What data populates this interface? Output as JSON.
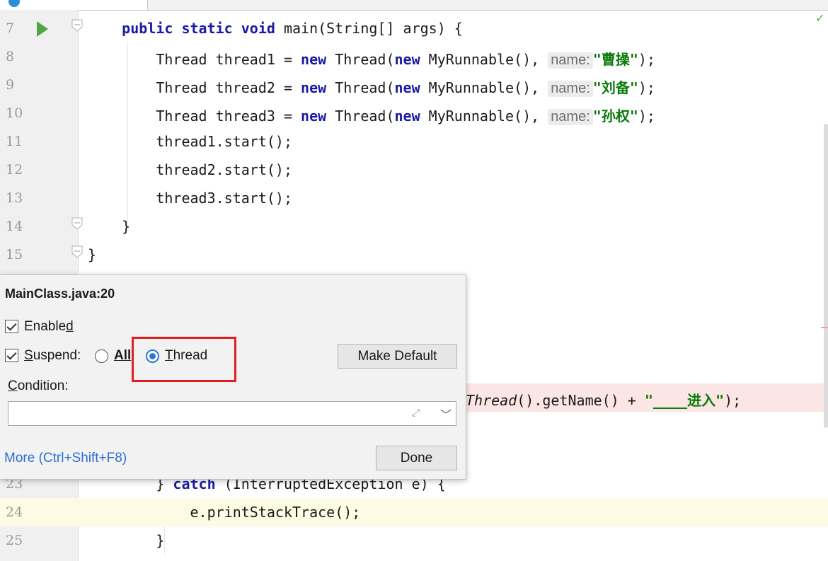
{
  "editor": {
    "lines": [
      {
        "num": "7",
        "code": [
          {
            "t": "    "
          },
          {
            "t": "public static void",
            "k": "kw"
          },
          {
            "t": " main(String[] args) {"
          }
        ]
      },
      {
        "num": "8",
        "code": [
          {
            "t": "        Thread thread1 = "
          },
          {
            "t": "new",
            "k": "kw"
          },
          {
            "t": " Thread("
          },
          {
            "t": "new",
            "k": "kw"
          },
          {
            "t": " MyRunnable(),"
          },
          {
            "hint": "name:"
          },
          {
            "t": "\"曹操\"",
            "k": "str"
          },
          {
            "t": ");"
          }
        ]
      },
      {
        "num": "9",
        "code": [
          {
            "t": "        Thread thread2 = "
          },
          {
            "t": "new",
            "k": "kw"
          },
          {
            "t": " Thread("
          },
          {
            "t": "new",
            "k": "kw"
          },
          {
            "t": " MyRunnable(),"
          },
          {
            "hint": "name:"
          },
          {
            "t": "\"刘备\"",
            "k": "str"
          },
          {
            "t": ");"
          }
        ]
      },
      {
        "num": "10",
        "code": [
          {
            "t": "        Thread thread3 = "
          },
          {
            "t": "new",
            "k": "kw"
          },
          {
            "t": " Thread("
          },
          {
            "t": "new",
            "k": "kw"
          },
          {
            "t": " MyRunnable(),"
          },
          {
            "hint": "name:"
          },
          {
            "t": "\"孙权\"",
            "k": "str"
          },
          {
            "t": ");"
          }
        ]
      },
      {
        "num": "11",
        "code": [
          {
            "t": "        thread1.start();"
          }
        ]
      },
      {
        "num": "12",
        "code": [
          {
            "t": "        thread2.start();"
          }
        ]
      },
      {
        "num": "13",
        "code": [
          {
            "t": "        thread3.start();"
          }
        ]
      },
      {
        "num": "14",
        "code": [
          {
            "t": "    }"
          }
        ]
      },
      {
        "num": "15",
        "code": [
          {
            "t": "}"
          }
        ]
      }
    ],
    "hidden_line": {
      "code": [
        {
          "t": "Thread",
          "k": "it"
        },
        {
          "t": "().getName() + "
        },
        {
          "t": "\"____进入\"",
          "k": "str"
        },
        {
          "t": ");"
        }
      ]
    },
    "bottom_lines": [
      {
        "num": "23",
        "code": [
          {
            "t": "        } "
          },
          {
            "t": "catch",
            "k": "kw"
          },
          {
            "t": " (InterruptedException e) {"
          }
        ]
      },
      {
        "num": "24",
        "code": [
          {
            "t": "            e.printStackTrace();"
          }
        ]
      },
      {
        "num": "25",
        "code": [
          {
            "t": "        }"
          }
        ]
      }
    ]
  },
  "popup": {
    "title": "MainClass.java:20",
    "enabled_label_prefix": "Enable",
    "enabled_label_accel": "d",
    "suspend_label_accel": "S",
    "suspend_label_rest": "uspend:",
    "all_label_accel": "All",
    "thread_label_accel": "T",
    "thread_label_rest": "hread",
    "make_default_label": "Make Default",
    "condition_label_accel": "C",
    "condition_label_rest": "ondition:",
    "condition_value": "",
    "more_link": "More (Ctrl+Shift+F8)",
    "done_label": "Done"
  },
  "colors": {
    "keyword": "#1a1aa6",
    "string": "#0a7a0a",
    "highlight": "#e02020",
    "link": "#2b6fd0"
  },
  "icons": [
    "run-icon",
    "fold-icon",
    "expand-icon",
    "chevron-down-icon",
    "check-icon"
  ]
}
